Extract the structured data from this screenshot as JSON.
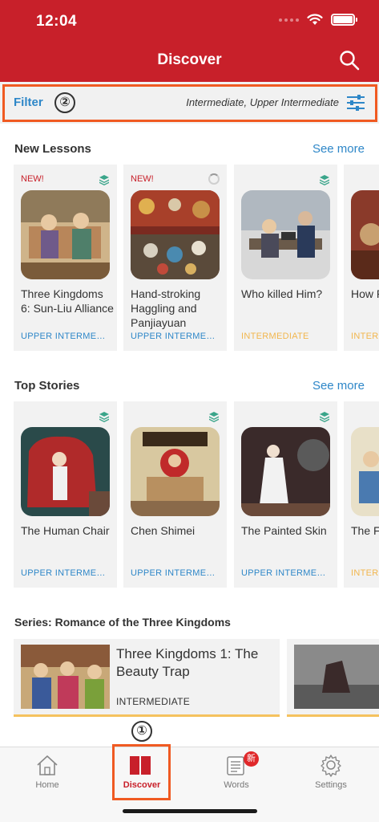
{
  "status_bar": {
    "time": "12:04"
  },
  "header": {
    "title": "Discover"
  },
  "filter": {
    "label": "Filter",
    "value": "Intermediate, Upper Intermediate"
  },
  "annotations": {
    "filter_marker": "②",
    "discover_marker": "①"
  },
  "new_lessons": {
    "title": "New Lessons",
    "see_more": "See more",
    "cards": [
      {
        "badge": "NEW!",
        "status_icon": "stack-icon",
        "title": "Three Kingdoms 6: Sun-Liu Alliance",
        "level": "UPPER INTERMEDIATE"
      },
      {
        "badge": "NEW!",
        "status_icon": "loading-icon",
        "title": "Hand-stroking Haggling and Panjiayuan",
        "level": "UPPER INTERMEDIATE"
      },
      {
        "badge": "",
        "status_icon": "stack-icon",
        "title": "Who killed Him?",
        "level": "INTERMEDIATE"
      },
      {
        "badge": "",
        "status_icon": "",
        "title": "How People Chine",
        "level": "INTER"
      }
    ]
  },
  "top_stories": {
    "title": "Top Stories",
    "see_more": "See more",
    "cards": [
      {
        "status_icon": "stack-icon",
        "title": "The Human Chair",
        "level": "UPPER INTERMEDIATE"
      },
      {
        "status_icon": "stack-icon",
        "title": "Chen Shimei",
        "level": "UPPER INTERMEDIATE"
      },
      {
        "status_icon": "stack-icon",
        "title": "The Painted Skin",
        "level": "UPPER INTERMEDIATE"
      },
      {
        "status_icon": "",
        "title": "The F Cricke",
        "level": "INTER"
      }
    ]
  },
  "series": {
    "title": "Series: Romance of the Three Kingdoms",
    "items": [
      {
        "title": "Three Kingdoms 1: The Beauty Trap",
        "level": "INTERMEDIATE"
      }
    ]
  },
  "tabs": [
    {
      "label": "Home",
      "icon": "home-icon"
    },
    {
      "label": "Discover",
      "icon": "book-icon",
      "active": true
    },
    {
      "label": "Words",
      "icon": "flashcards-icon",
      "badge": "新"
    },
    {
      "label": "Settings",
      "icon": "gear-icon"
    }
  ],
  "colors": {
    "brand_red": "#c8202a",
    "link_blue": "#2e87c8",
    "level_yellow": "#f2b64d",
    "highlight_orange": "#f05a22"
  }
}
